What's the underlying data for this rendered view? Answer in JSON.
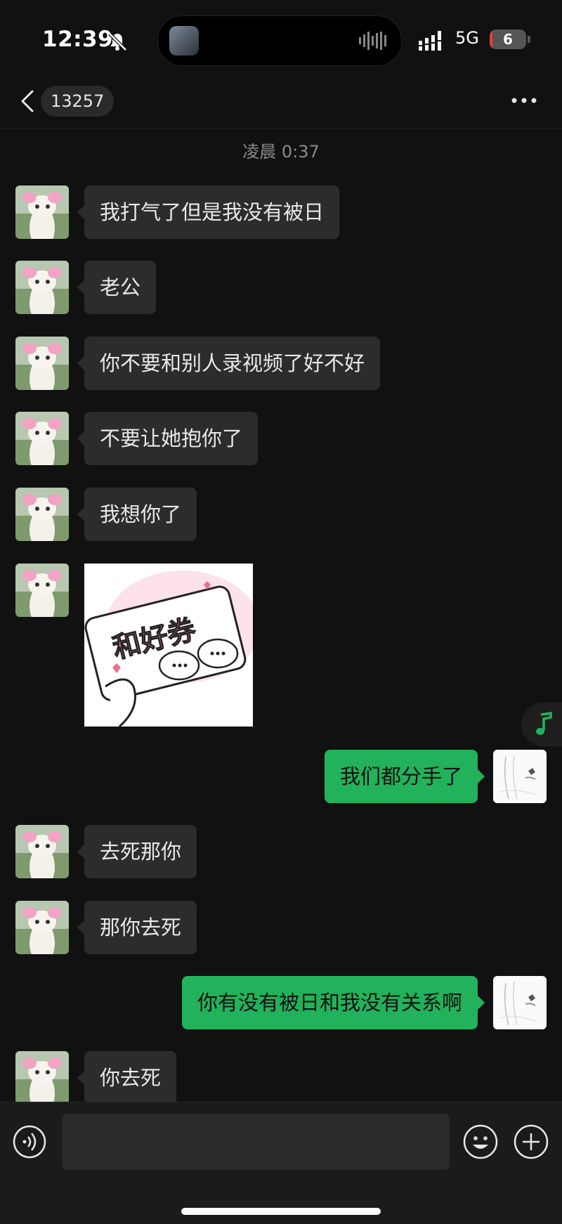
{
  "status_bar": {
    "time": "12:39",
    "network": "5G",
    "battery_level": "6",
    "battery_fraction": 0.06
  },
  "header": {
    "title": "13257"
  },
  "timestamp": "凌晨 0:37",
  "messages": [
    {
      "dir": "in",
      "text": "我打气了但是我没有被日"
    },
    {
      "dir": "in",
      "text": "老公"
    },
    {
      "dir": "in",
      "text": "你不要和别人录视频了好不好"
    },
    {
      "dir": "in",
      "text": "不要让她抱你了"
    },
    {
      "dir": "in",
      "text": "我想你了"
    },
    {
      "dir": "in",
      "sticker_text": "和好券"
    },
    {
      "dir": "out",
      "text": "我们都分手了"
    },
    {
      "dir": "in",
      "text": "去死那你"
    },
    {
      "dir": "in",
      "text": "那你去死"
    },
    {
      "dir": "out",
      "text": "你有没有被日和我没有关系啊"
    },
    {
      "dir": "in",
      "text": "你去死"
    }
  ],
  "colors": {
    "outgoing_bubble": "#22b25c",
    "incoming_bubble": "#2c2c2c",
    "background": "#111111",
    "battery_low": "#e23c3c"
  },
  "icons": [
    "bell-muted-icon",
    "signal-icon",
    "back-icon",
    "more-icon",
    "music-note-icon",
    "voice-icon",
    "emoji-icon",
    "plus-icon"
  ]
}
